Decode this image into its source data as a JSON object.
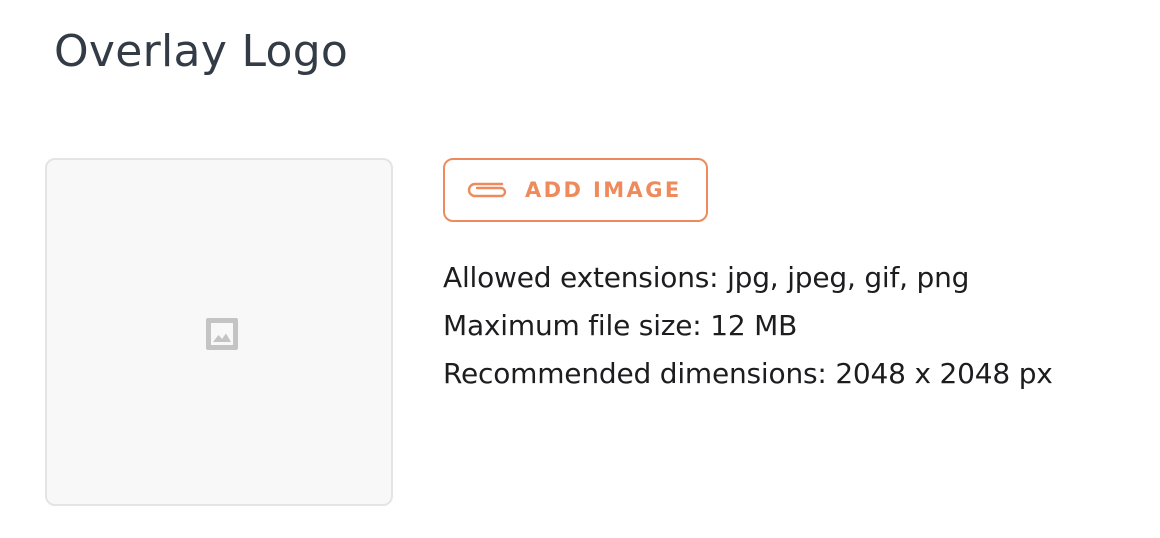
{
  "section": {
    "title": "Overlay Logo"
  },
  "upload": {
    "button_label": "ADD IMAGE",
    "preview_icon": "image-placeholder-icon",
    "button_icon": "paperclip-icon"
  },
  "info": {
    "extensions": "Allowed extensions: jpg, jpeg, gif, png",
    "max_size": "Maximum file size: 12 MB",
    "dimensions": "Recommended dimensions: 2048 x 2048 px"
  },
  "colors": {
    "accent": "#ee8a5c",
    "title_text": "#323b46",
    "body_text": "#1d1d1f",
    "preview_bg": "#f8f8f8",
    "preview_border": "#e4e4e4",
    "icon_gray": "#c4c4c4"
  }
}
